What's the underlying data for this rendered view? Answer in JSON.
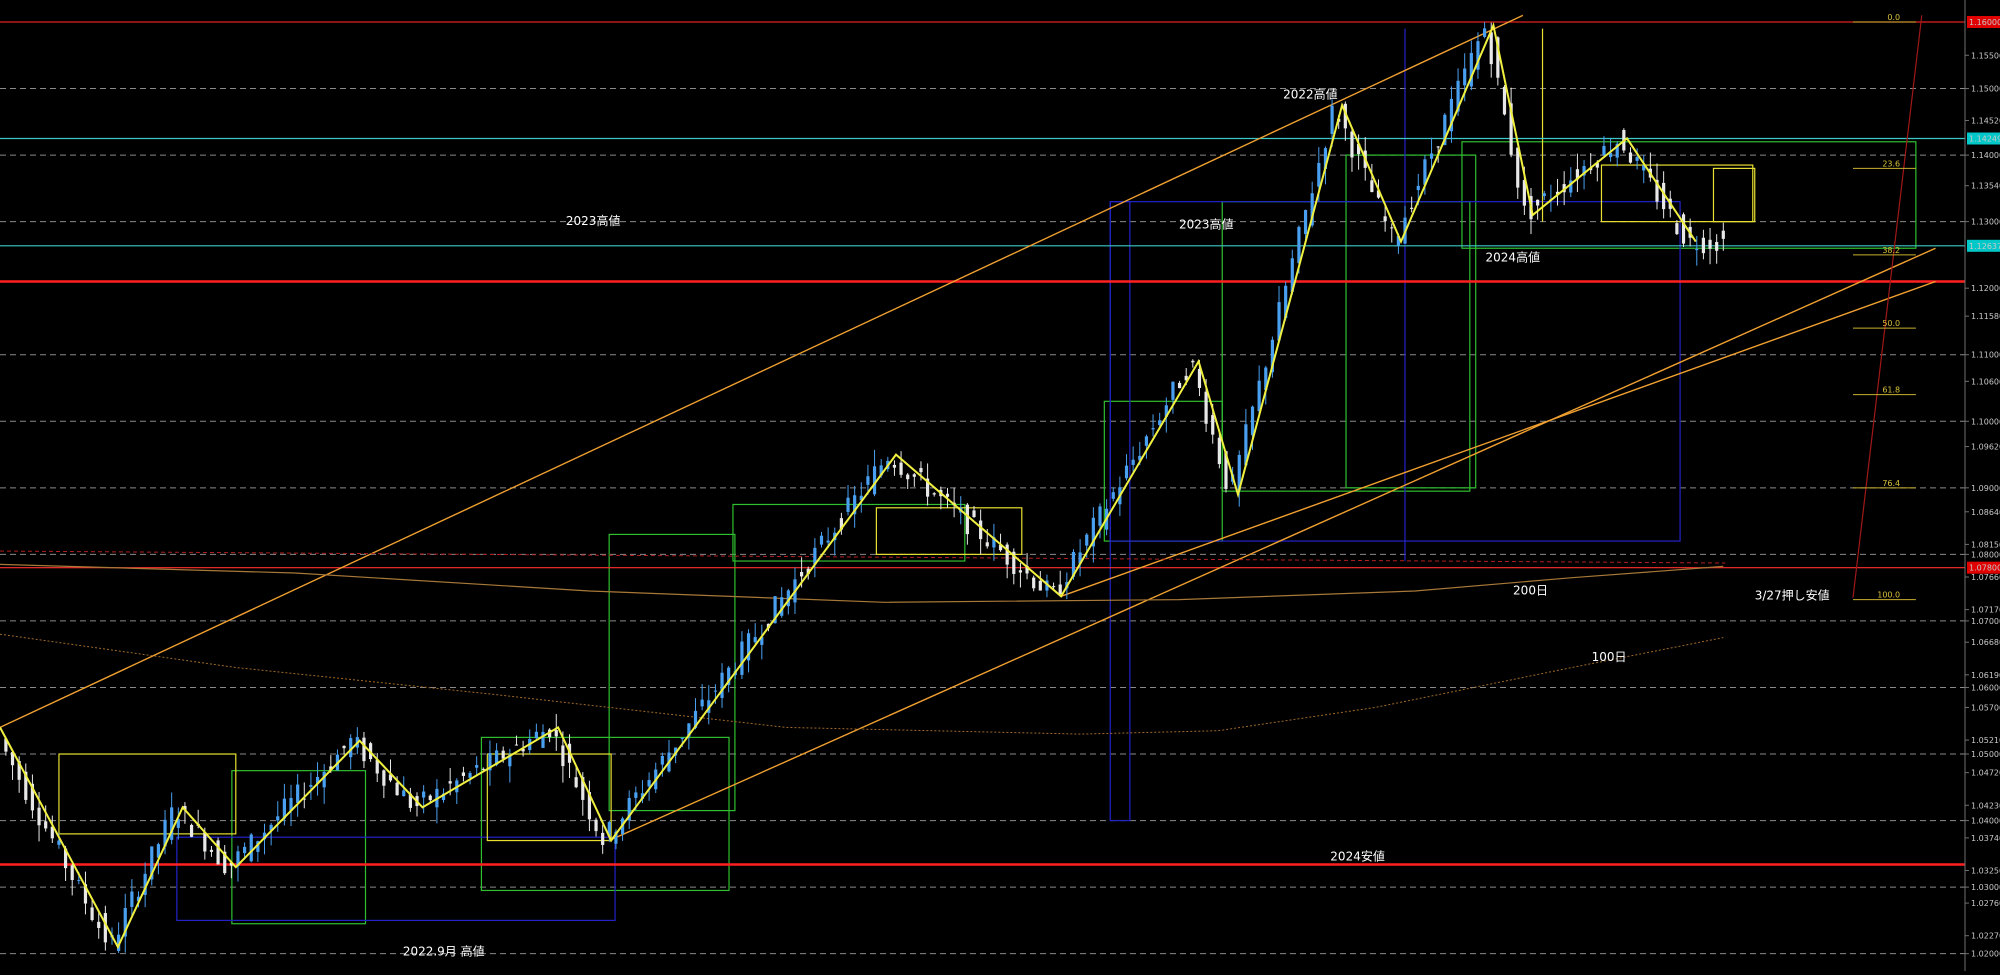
{
  "chart_data": {
    "type": "candlestick",
    "title": "",
    "xlabel": "",
    "ylabel": "",
    "ylim": [
      1.0195,
      1.1615
    ],
    "price_ticks": [
      1.155,
      1.15,
      1.1452,
      1.14,
      1.1354,
      1.13,
      1.12,
      1.1158,
      1.11,
      1.106,
      1.1,
      1.0962,
      1.09,
      1.0864,
      1.0815,
      1.08,
      1.0766,
      1.0717,
      1.07,
      1.0668,
      1.0619,
      1.06,
      1.057,
      1.0521,
      1.05,
      1.0472,
      1.0423,
      1.04,
      1.0374,
      1.0325,
      1.03,
      1.0276,
      1.0227,
      1.02
    ],
    "price_labels": [
      "1.15500",
      "1.15000",
      "1.14520",
      "1.14000",
      "1.13540",
      "1.13000",
      "1.12000",
      "1.11580",
      "1.11000",
      "1.10600",
      "1.10000",
      "1.09620",
      "1.09000",
      "1.08640",
      "1.08150",
      "1.08000",
      "1.07660",
      "1.07170",
      "1.07000",
      "1.06680",
      "1.06190",
      "1.06000",
      "1.05700",
      "1.05210",
      "1.05000",
      "1.04720",
      "1.04230",
      "1.04000",
      "1.03740",
      "1.03250",
      "1.03000",
      "1.02760",
      "1.02270",
      "1.02000"
    ],
    "dashed_levels": [
      1.15,
      1.14,
      1.13,
      1.11,
      1.1,
      1.09,
      1.08,
      1.07,
      1.06,
      1.05,
      1.04,
      1.03,
      1.02
    ],
    "highlight_labels": [
      {
        "price": 1.16,
        "label": "1.16000",
        "color": "#e00000"
      },
      {
        "price": 1.14249,
        "label": "1.14249",
        "color": "#00c8c8"
      },
      {
        "price": 1.12637,
        "label": "1.12637",
        "color": "#00c8c8"
      },
      {
        "price": 1.078,
        "label": "1.07800",
        "color": "#e00000"
      }
    ],
    "horizontal_lines": [
      {
        "price": 1.16,
        "color": "#e02020",
        "width": 1.2
      },
      {
        "price": 1.14249,
        "color": "#3cc8c8",
        "width": 1.2
      },
      {
        "price": 1.12637,
        "color": "#3cc8c8",
        "width": 1.2
      },
      {
        "price": 1.121,
        "color": "#ff2020",
        "width": 2.5
      },
      {
        "price": 1.0334,
        "color": "#ff2020",
        "width": 2.5
      },
      {
        "price": 1.078,
        "color": "#ff3030",
        "width": 1.2
      }
    ],
    "fibonacci": [
      {
        "level": "0.0",
        "price": 1.16
      },
      {
        "level": "23.6",
        "price": 1.138
      },
      {
        "level": "38.2",
        "price": 1.125
      },
      {
        "level": "50.0",
        "price": 1.114
      },
      {
        "level": "61.8",
        "price": 1.104
      },
      {
        "level": "76.4",
        "price": 1.09
      },
      {
        "level": "100.0",
        "price": 1.0732
      }
    ],
    "annotations": [
      {
        "text": "2022高値",
        "x": 0.653,
        "price": 1.1485
      },
      {
        "text": "2023高値",
        "x": 0.288,
        "price": 1.1295
      },
      {
        "text": "2023高値",
        "x": 0.6,
        "price": 1.129
      },
      {
        "text": "2024高値",
        "x": 0.756,
        "price": 1.124
      },
      {
        "text": "200日",
        "x": 0.77,
        "price": 1.074
      },
      {
        "text": "3/27押し安値",
        "x": 0.893,
        "price": 1.0732
      },
      {
        "text": "100日",
        "x": 0.81,
        "price": 1.064
      },
      {
        "text": "2024安値",
        "x": 0.677,
        "price": 1.034
      },
      {
        "text": "2022.9月 高値",
        "x": 0.205,
        "price": 1.0197
      }
    ],
    "zigzag_points": [
      [
        0.0,
        1.054
      ],
      [
        0.06,
        1.021
      ],
      [
        0.093,
        1.042
      ],
      [
        0.12,
        1.033
      ],
      [
        0.183,
        1.052
      ],
      [
        0.215,
        1.042
      ],
      [
        0.284,
        1.054
      ],
      [
        0.311,
        1.037
      ],
      [
        0.456,
        1.095
      ],
      [
        0.54,
        1.0737
      ],
      [
        0.61,
        1.109
      ],
      [
        0.63,
        1.089
      ],
      [
        0.683,
        1.1475
      ],
      [
        0.713,
        1.127
      ],
      [
        0.76,
        1.1595
      ],
      [
        0.78,
        1.131
      ],
      [
        0.828,
        1.1425
      ],
      [
        0.863,
        1.127
      ]
    ],
    "candles": []
  }
}
